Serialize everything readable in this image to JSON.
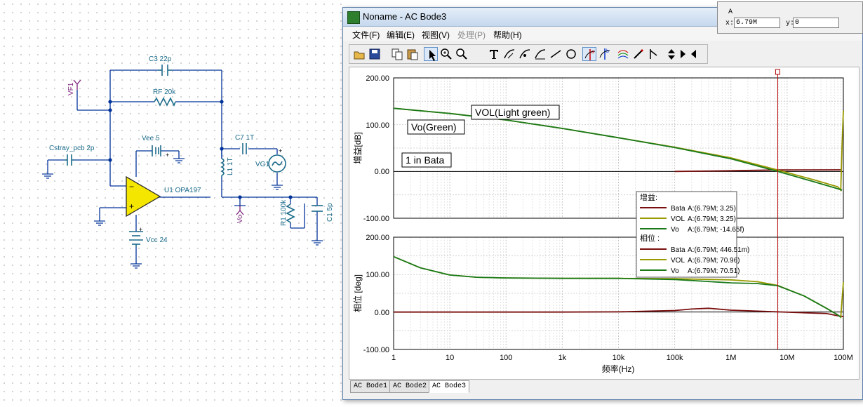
{
  "schematic": {
    "labels": {
      "c3": "C3 22p",
      "rf": "RF 20k",
      "vee": "Vee 5",
      "c7": "C7 1T",
      "cstray": "Cstray_pcb 2p",
      "l1": "L1 1T",
      "vg1": "VG1",
      "u1": "U1 OPA197",
      "vf1": "VF1",
      "vo": "Vo",
      "r1": "R1 100k",
      "c1": "C1 5p",
      "vcc": "Vcc 24"
    },
    "colors": {
      "wire": "#003399",
      "component": "#1a6b8a",
      "opamp": "#f5e600",
      "probe": "#7a1f7a"
    }
  },
  "window": {
    "title": "Noname - AC Bode3",
    "menu": [
      {
        "label": "文件(F)",
        "enabled": true
      },
      {
        "label": "编辑(E)",
        "enabled": true
      },
      {
        "label": "视图(V)",
        "enabled": true
      },
      {
        "label": "处理(P)",
        "enabled": false
      },
      {
        "label": "帮助(H)",
        "enabled": true
      }
    ],
    "toolbar": [
      "open-icon",
      "save-icon",
      "copy-icon",
      "paste-icon",
      "arrow-select-icon",
      "zoom-in-icon",
      "zoom-100-icon",
      "text-icon",
      "label-curve-icon",
      "label-point-icon",
      "label-axis-icon",
      "line-icon",
      "circle-icon",
      "cursor-a-icon",
      "cursor-b-icon",
      "curve-style-icon",
      "pen-icon",
      "flag-icon",
      "arrow-up-icon",
      "arrow-down-icon",
      "arrow-right-icon"
    ],
    "tabs": [
      {
        "label": "AC Bode1",
        "active": false
      },
      {
        "label": "AC Bode2",
        "active": false
      },
      {
        "label": "AC Bode3",
        "active": true
      }
    ]
  },
  "cursor_panel": {
    "cursor_name": "A",
    "x_label": "x:",
    "x_value": "6.79M",
    "y_label": "y:",
    "y_value": "0"
  },
  "chart_data": [
    {
      "type": "line",
      "ylabel": "增益[dB]",
      "x_scale": "log",
      "xlim": [
        1,
        100000000
      ],
      "ylim": [
        -100,
        200
      ],
      "ytick_labels": [
        "200.00",
        "100.00",
        "0.00",
        "-100.00"
      ],
      "grid": true,
      "annotations": [
        "VOL(Light green)",
        "Vo(Green)",
        "1 in Bata"
      ],
      "cursor_x": 6790000,
      "series": [
        {
          "name": "Bata",
          "color": "#7a0f0f",
          "x": [
            100000,
            1000000,
            6790000,
            90000000
          ],
          "y": [
            0,
            1.5,
            3.25,
            3.5
          ]
        },
        {
          "name": "VOL",
          "color": "#999900",
          "x": [
            1,
            10,
            100,
            1000,
            10000,
            100000,
            1000000,
            6790000,
            30000000,
            80000000,
            90000000,
            95000000,
            100000000
          ],
          "y": [
            135,
            124,
            110,
            92,
            72,
            52,
            29,
            3.25,
            -18,
            -33,
            -40,
            60,
            130
          ]
        },
        {
          "name": "Vo",
          "color": "#1a7a1a",
          "x": [
            1,
            10,
            100,
            1000,
            10000,
            100000,
            1000000,
            6790000,
            30000000,
            80000000,
            95000000
          ],
          "y": [
            135,
            124,
            110,
            92,
            72,
            51,
            27,
            -1.4e-05,
            -22,
            -37,
            -40
          ]
        }
      ]
    },
    {
      "type": "line",
      "ylabel": "相位 [deg]",
      "xlabel": "频率(Hz)",
      "x_scale": "log",
      "xlim": [
        1,
        100000000
      ],
      "ylim": [
        -100,
        200
      ],
      "ytick_labels": [
        "200.00",
        "100.00",
        "0.00",
        "-100.00"
      ],
      "xtick_labels": [
        "1",
        "10",
        "100",
        "1k",
        "10k",
        "100k",
        "1M",
        "10M",
        "100M"
      ],
      "grid": true,
      "cursor_x": 6790000,
      "series": [
        {
          "name": "Bata",
          "color": "#7a0f0f",
          "x": [
            1,
            10,
            100,
            1000,
            10000,
            100000,
            200000,
            400000,
            1000000,
            6790000,
            20000000,
            50000000,
            80000000,
            100000000
          ],
          "y": [
            0,
            0,
            0,
            0,
            0.5,
            4,
            8,
            10,
            5,
            0.45,
            -2,
            -4,
            -10,
            -12
          ]
        },
        {
          "name": "VOL",
          "color": "#999900",
          "x": [
            1,
            3,
            10,
            30,
            100,
            1000,
            10000,
            100000,
            1000000,
            3000000,
            6790000,
            20000000,
            50000000,
            80000000,
            90000000,
            100000000
          ],
          "y": [
            148,
            118,
            99,
            93,
            91,
            90,
            90,
            89,
            86,
            81,
            71,
            43,
            10,
            -8,
            -14,
            80
          ]
        },
        {
          "name": "Vo",
          "color": "#1a7a1a",
          "x": [
            1,
            3,
            10,
            30,
            100,
            1000,
            10000,
            100000,
            1000000,
            3000000,
            6790000,
            20000000,
            50000000,
            80000000,
            90000000
          ],
          "y": [
            148,
            118,
            99,
            93,
            91,
            90,
            90,
            87,
            78,
            76,
            70.51,
            43,
            10,
            -8,
            -14
          ]
        }
      ]
    }
  ],
  "legend": {
    "gain_header": "增益:",
    "phase_header": "相位 :",
    "gain_rows": [
      {
        "name": "Bata",
        "value": "A:(6.79M; 3.25)",
        "color": "#7a0f0f"
      },
      {
        "name": "VOL",
        "value": "A:(6.79M; 3.25)",
        "color": "#999900"
      },
      {
        "name": "Vo",
        "value": "A:(6.79M; -14.65f)",
        "color": "#1a7a1a"
      }
    ],
    "phase_rows": [
      {
        "name": "Bata",
        "value": "A:(6.79M; 446.51m)",
        "color": "#7a0f0f"
      },
      {
        "name": "VOL",
        "value": "A:(6.79M; 70.96)",
        "color": "#999900"
      },
      {
        "name": "Vo",
        "value": "A:(6.79M; 70.51)",
        "color": "#1a7a1a"
      }
    ]
  }
}
